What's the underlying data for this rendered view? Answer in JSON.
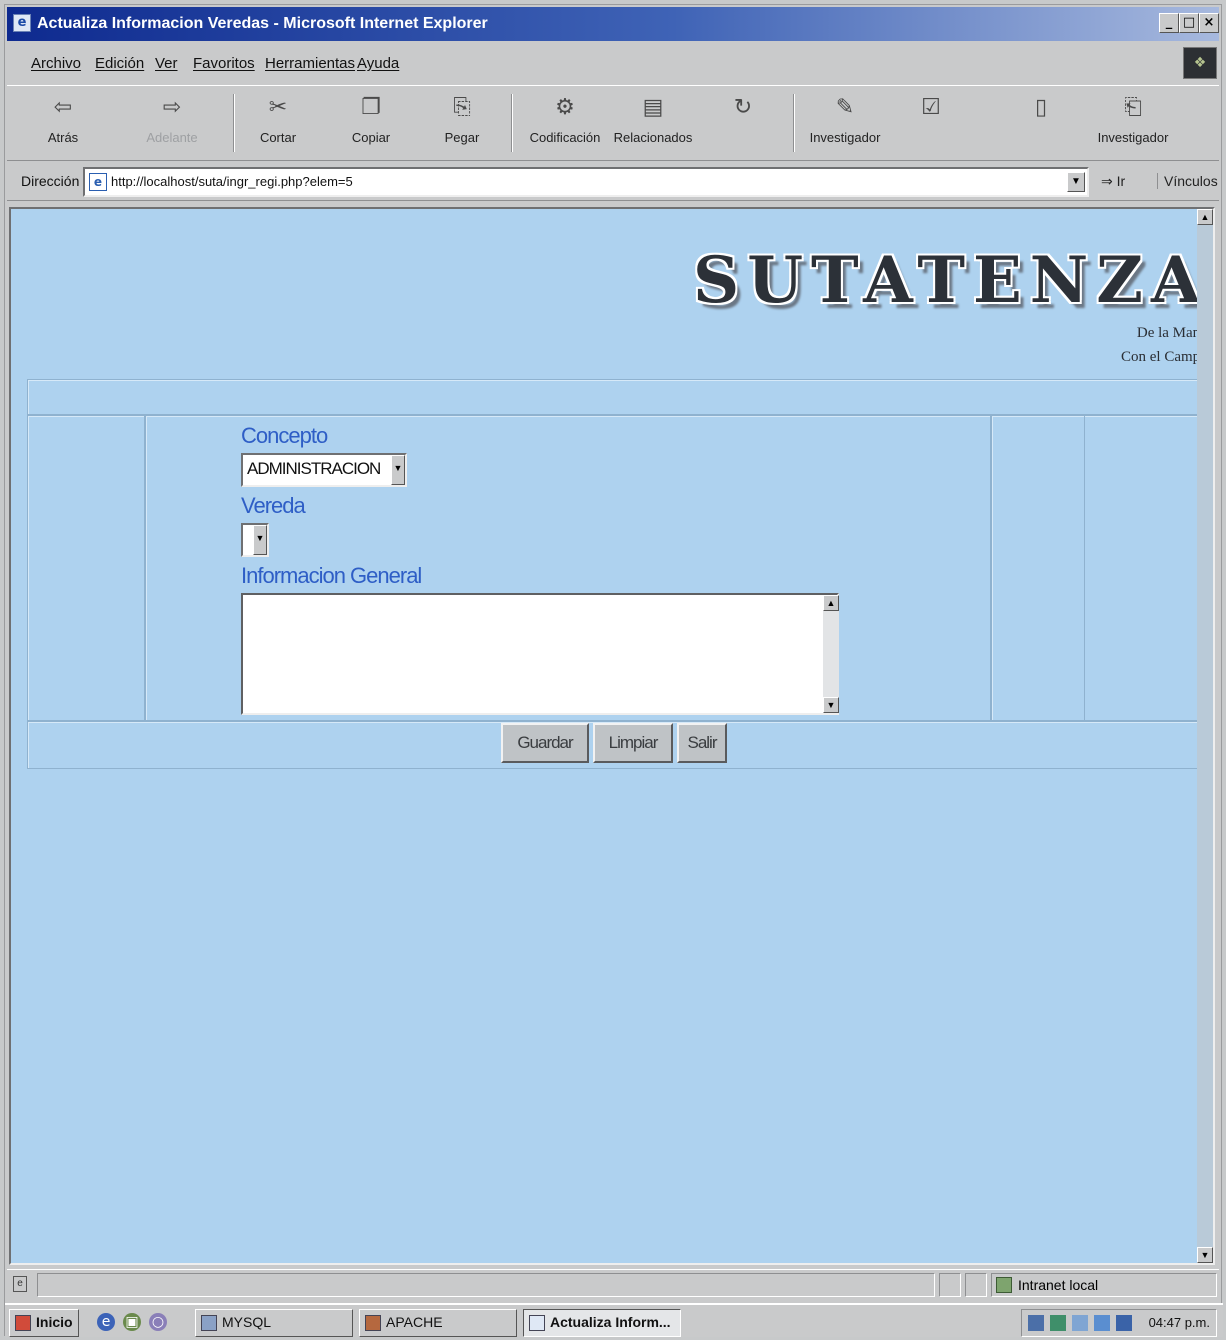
{
  "window": {
    "title": "Actualiza Informacion Veredas - Microsoft Internet Explorer",
    "controls": [
      "_",
      "□",
      "×"
    ]
  },
  "menu": [
    "Archivo",
    "Edición",
    "Ver",
    "Favoritos",
    "Herramientas",
    "Ayuda"
  ],
  "toolbar": [
    {
      "label": "Atrás",
      "icon": "back-arrow-icon",
      "glyph": "⇦"
    },
    {
      "label": "Adelante",
      "icon": "forward-arrow-icon",
      "glyph": "⇨"
    },
    {
      "label": "Cortar",
      "icon": "cut-icon",
      "glyph": "✂"
    },
    {
      "label": "Copiar",
      "icon": "copy-icon",
      "glyph": "❐"
    },
    {
      "label": "Pegar",
      "icon": "paste-icon",
      "glyph": "⎘"
    },
    {
      "label": "Codificación",
      "icon": "encoding-icon",
      "glyph": "⚙"
    },
    {
      "label": "Relacionados",
      "icon": "related-icon",
      "glyph": "▤"
    },
    {
      "label": "Investigador",
      "icon": "researcher-icon",
      "glyph": "✎"
    },
    {
      "label": "Investigador",
      "icon": "researcher-icon-2",
      "glyph": "⎗"
    }
  ],
  "address": {
    "label": "Dirección",
    "url": "http://localhost/suta/ingr_regi.php?elem=5",
    "go": "Ir",
    "links": "Vínculos"
  },
  "page": {
    "logo": "SUTATENZA",
    "slogan_line1": "De la Mano",
    "slogan_line2": "Con el Campo",
    "concepto_label": "Concepto",
    "concepto_value": "ADMINISTRACION",
    "vereda_label": "Vereda",
    "vereda_value": "",
    "info_label": "Informacion General",
    "info_value": "",
    "buttons": [
      "Guardar",
      "Limpiar",
      "Salir"
    ]
  },
  "status": {
    "zone": "Intranet local"
  },
  "taskbar": {
    "start": "Inicio",
    "tasks": [
      "MYSQL",
      "APACHE",
      "Actualiza Inform..."
    ],
    "clock": "04:47 p.m."
  },
  "colors": {
    "page_background": "#aed2ef",
    "label_blue": "#2e5ec6",
    "titlebar_start": "#0e2a8f"
  }
}
